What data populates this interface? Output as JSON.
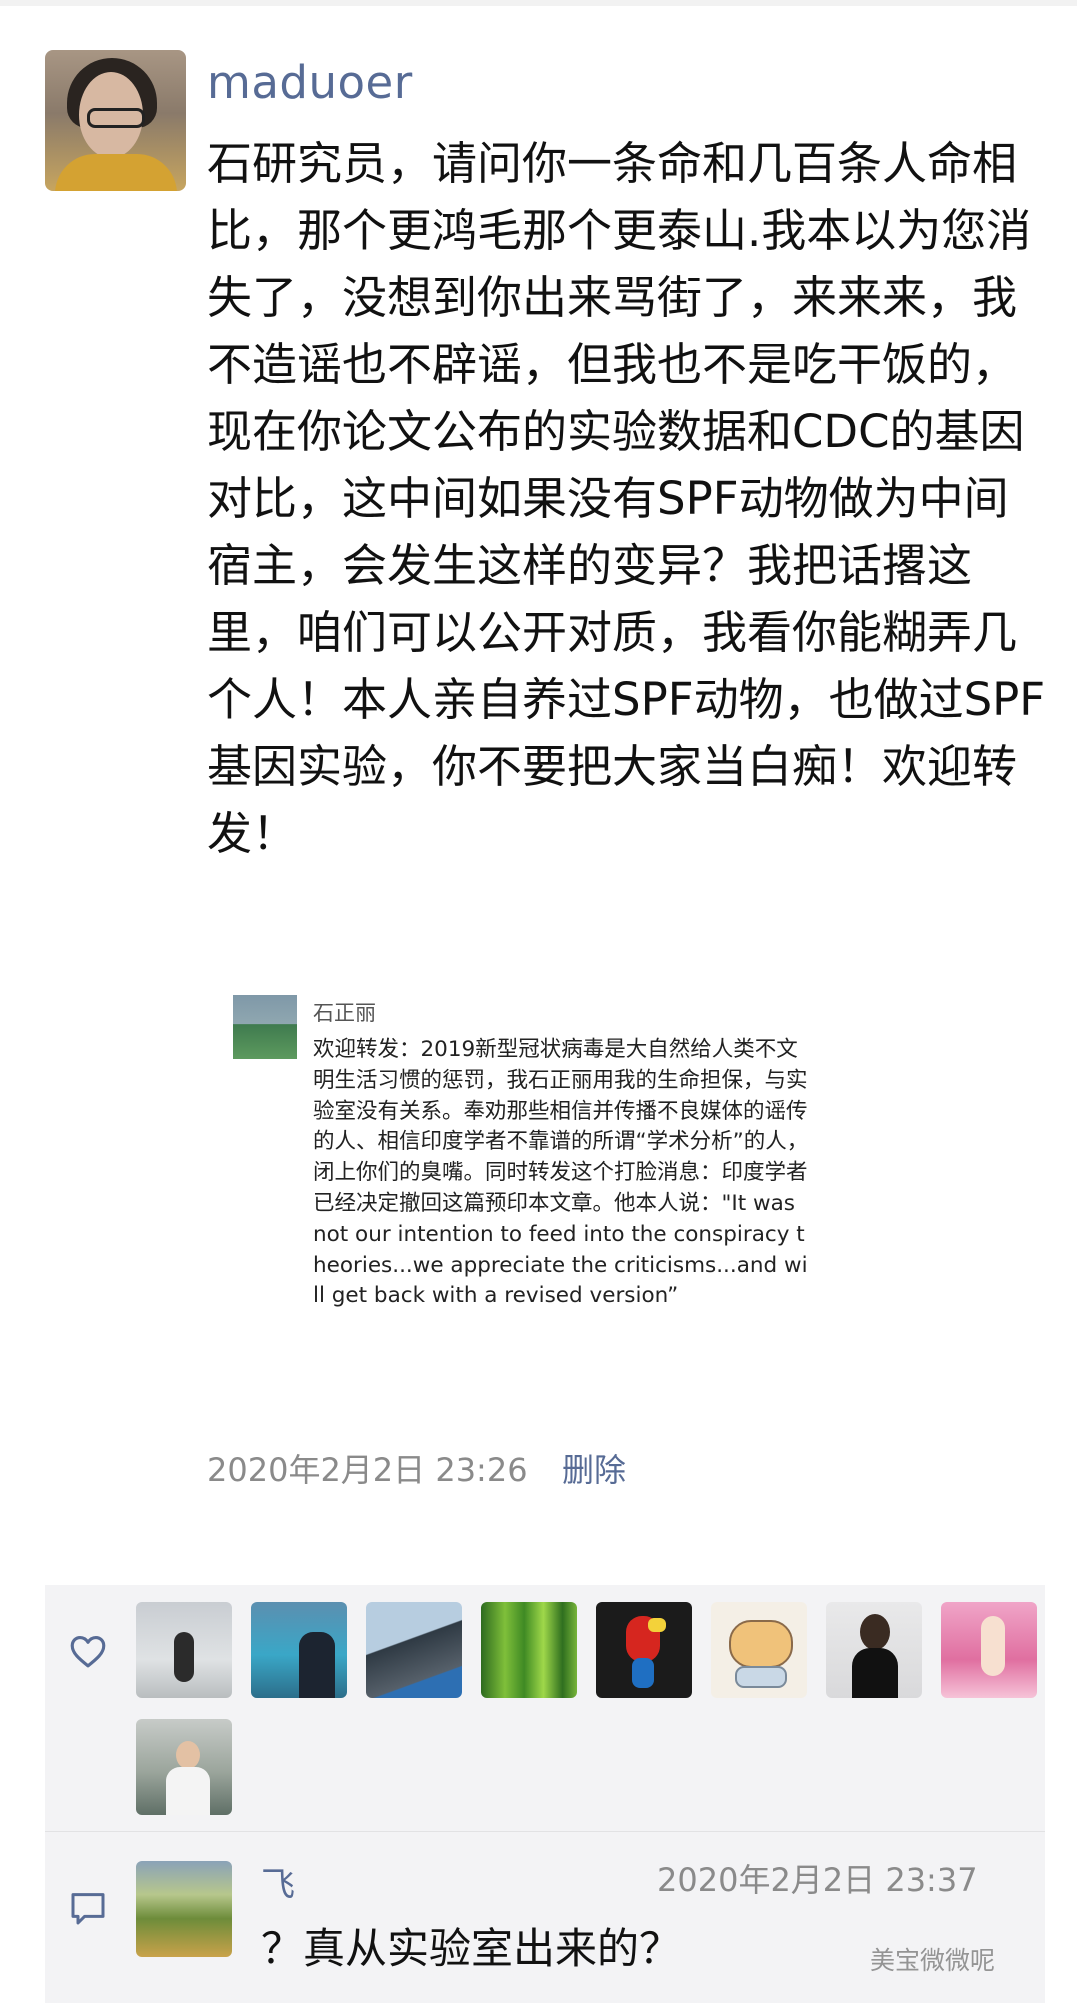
{
  "post": {
    "author": "maduoer",
    "content": "石研究员，请问你一条命和几百条人命相比，那个更鸿毛那个更泰山.我本以为您消失了，没想到你出来骂街了，来来来，我不造谣也不辟谣，但我也不是吃干饭的，现在你论文公布的实验数据和CDC的基因对比，这中间如果没有SPF动物做为中间宿主，会发生这样的变异？我把话撂这里，咱们可以公开对质，我看你能糊弄几个人！本人亲自养过SPF动物，也做过SPF基因实验，你不要把大家当白痴！欢迎转发！",
    "timestamp": "2020年2月2日 23:26",
    "delete_label": "删除"
  },
  "shared": {
    "author": "石正丽",
    "text": "欢迎转发：2019新型冠状病毒是大自然给人类不文明生活习惯的惩罚，我石正丽用我的生命担保，与实验室没有关系。奉劝那些相信并传播不良媒体的谣传的人、相信印度学者不靠谱的所谓“学术分析”的人，闭上你们的臭嘴。同时转发这个打脸消息：印度学者已经决定撤回这篇预印本文章。他本人说：\"It was not our intention to feed into the conspiracy theories...we appreciate the criticisms...and will get back with a revised version”"
  },
  "likes": {
    "icon": "heart-icon",
    "avatars": [
      "like-avatar-1",
      "like-avatar-2",
      "like-avatar-3",
      "like-avatar-4",
      "like-avatar-5",
      "like-avatar-6",
      "like-avatar-7",
      "like-avatar-8",
      "like-avatar-9"
    ]
  },
  "comment": {
    "icon": "comment-icon",
    "author": "飞",
    "timestamp": "2020年2月2日 23:37",
    "text": "？真从实验室出来的？"
  },
  "watermark": "美宝微微呢"
}
